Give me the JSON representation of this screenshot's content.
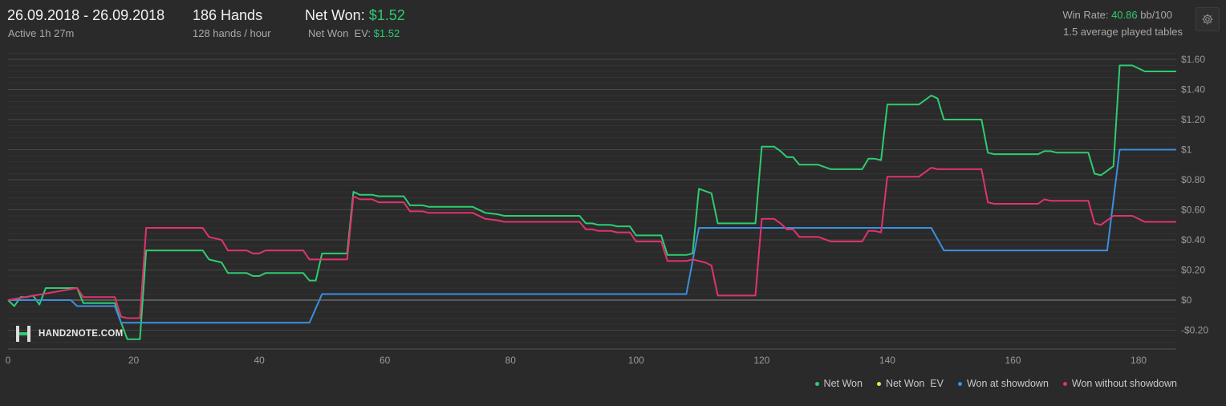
{
  "header": {
    "date_range": "26.09.2018 - 26.09.2018",
    "active": "Active 1h 27m",
    "hands": "186 Hands",
    "hands_per_hour": "128 hands / hour",
    "net_won_label": "Net Won: ",
    "net_won_value": "$1.52",
    "net_won_ev_label": "Net Won  EV: ",
    "net_won_ev_value": "$1.52",
    "win_rate_label": "Win Rate: ",
    "win_rate_value": "40.86",
    "win_rate_unit": " bb/100",
    "tables": "1.5 average played tables"
  },
  "logo": {
    "text": "HAND2NOTE.COM"
  },
  "colors": {
    "net_won": "#2ecc71",
    "net_won_ev": "#e8e84a",
    "showdown": "#3b8fe0",
    "non_showdown": "#e0336e",
    "background": "#2a2a2a",
    "grid": "#3c3c3c",
    "zero_line": "#8a8a8a"
  },
  "icons": {
    "settings": "gear-icon"
  },
  "chart_data": {
    "type": "line",
    "xlim": [
      0,
      186
    ],
    "ylim": [
      -0.3,
      1.65
    ],
    "x_ticks": [
      0,
      20,
      40,
      60,
      80,
      100,
      120,
      140,
      160,
      180
    ],
    "x_tick_labels": [
      "0",
      "20",
      "40",
      "60",
      "80",
      "100",
      "120",
      "140",
      "160",
      "180"
    ],
    "y_ticks": [
      -0.2,
      0,
      0.2,
      0.4,
      0.6,
      0.8,
      1,
      1.2,
      1.4,
      1.6
    ],
    "y_tick_labels": [
      "-$0.20",
      "$0",
      "$0.20",
      "$0.40",
      "$0.60",
      "$0.80",
      "$1",
      "$1.20",
      "$1.40",
      "$1.60"
    ],
    "grid": true,
    "legend_position": "bottom-right",
    "series": [
      {
        "name": "Net Won",
        "color": "#2ecc71",
        "points": [
          [
            0,
            0
          ],
          [
            1,
            -0.04
          ],
          [
            2,
            0.02
          ],
          [
            3,
            0.02
          ],
          [
            4,
            0.03
          ],
          [
            5,
            -0.03
          ],
          [
            6,
            0.08
          ],
          [
            11,
            0.08
          ],
          [
            12,
            -0.02
          ],
          [
            17,
            -0.02
          ],
          [
            18,
            -0.15
          ],
          [
            19,
            -0.26
          ],
          [
            21,
            -0.26
          ],
          [
            22,
            0.33
          ],
          [
            31,
            0.33
          ],
          [
            32,
            0.27
          ],
          [
            34,
            0.25
          ],
          [
            35,
            0.18
          ],
          [
            38,
            0.18
          ],
          [
            39,
            0.16
          ],
          [
            40,
            0.16
          ],
          [
            41,
            0.18
          ],
          [
            47,
            0.18
          ],
          [
            48,
            0.13
          ],
          [
            49,
            0.13
          ],
          [
            50,
            0.31
          ],
          [
            54,
            0.31
          ],
          [
            55,
            0.72
          ],
          [
            56,
            0.7
          ],
          [
            58,
            0.7
          ],
          [
            59,
            0.69
          ],
          [
            63,
            0.69
          ],
          [
            64,
            0.63
          ],
          [
            66,
            0.63
          ],
          [
            67,
            0.62
          ],
          [
            74,
            0.62
          ],
          [
            76,
            0.58
          ],
          [
            78,
            0.57
          ],
          [
            79,
            0.56
          ],
          [
            91,
            0.56
          ],
          [
            92,
            0.51
          ],
          [
            93,
            0.51
          ],
          [
            94,
            0.5
          ],
          [
            96,
            0.5
          ],
          [
            97,
            0.49
          ],
          [
            99,
            0.49
          ],
          [
            100,
            0.43
          ],
          [
            104,
            0.43
          ],
          [
            105,
            0.3
          ],
          [
            108,
            0.3
          ],
          [
            109,
            0.31
          ],
          [
            110,
            0.74
          ],
          [
            112,
            0.71
          ],
          [
            113,
            0.51
          ],
          [
            119,
            0.51
          ],
          [
            120,
            1.02
          ],
          [
            122,
            1.02
          ],
          [
            123,
            0.99
          ],
          [
            124,
            0.95
          ],
          [
            125,
            0.95
          ],
          [
            126,
            0.9
          ],
          [
            129,
            0.9
          ],
          [
            131,
            0.87
          ],
          [
            136,
            0.87
          ],
          [
            137,
            0.94
          ],
          [
            138,
            0.94
          ],
          [
            139,
            0.93
          ],
          [
            140,
            1.3
          ],
          [
            145,
            1.3
          ],
          [
            147,
            1.36
          ],
          [
            148,
            1.34
          ],
          [
            149,
            1.2
          ],
          [
            155,
            1.2
          ],
          [
            156,
            0.98
          ],
          [
            157,
            0.97
          ],
          [
            164,
            0.97
          ],
          [
            165,
            0.99
          ],
          [
            166,
            0.99
          ],
          [
            167,
            0.98
          ],
          [
            172,
            0.98
          ],
          [
            173,
            0.84
          ],
          [
            174,
            0.83
          ],
          [
            175,
            0.86
          ],
          [
            176,
            0.89
          ],
          [
            177,
            1.56
          ],
          [
            179,
            1.56
          ],
          [
            181,
            1.52
          ],
          [
            186,
            1.52
          ]
        ]
      },
      {
        "name": "Net Won  EV",
        "color": "#e8e84a",
        "points": []
      },
      {
        "name": "Won at showdown",
        "color": "#3b8fe0",
        "points": [
          [
            0,
            0
          ],
          [
            10,
            0
          ],
          [
            11,
            -0.04
          ],
          [
            17,
            -0.04
          ],
          [
            18,
            -0.15
          ],
          [
            48,
            -0.15
          ],
          [
            50,
            0.04
          ],
          [
            108,
            0.04
          ],
          [
            110,
            0.48
          ],
          [
            147,
            0.48
          ],
          [
            149,
            0.33
          ],
          [
            175,
            0.33
          ],
          [
            177,
            1.0
          ],
          [
            186,
            1.0
          ]
        ]
      },
      {
        "name": "Won without showdown",
        "color": "#e0336e",
        "points": [
          [
            0,
            0
          ],
          [
            11,
            0.08
          ],
          [
            12,
            0.02
          ],
          [
            17,
            0.02
          ],
          [
            18,
            -0.11
          ],
          [
            19,
            -0.12
          ],
          [
            21,
            -0.12
          ],
          [
            22,
            0.48
          ],
          [
            31,
            0.48
          ],
          [
            32,
            0.42
          ],
          [
            34,
            0.4
          ],
          [
            35,
            0.33
          ],
          [
            38,
            0.33
          ],
          [
            39,
            0.31
          ],
          [
            40,
            0.31
          ],
          [
            41,
            0.33
          ],
          [
            47,
            0.33
          ],
          [
            48,
            0.27
          ],
          [
            49,
            0.27
          ],
          [
            50,
            0.27
          ],
          [
            54,
            0.27
          ],
          [
            55,
            0.69
          ],
          [
            56,
            0.67
          ],
          [
            58,
            0.67
          ],
          [
            59,
            0.65
          ],
          [
            63,
            0.65
          ],
          [
            64,
            0.59
          ],
          [
            66,
            0.59
          ],
          [
            67,
            0.58
          ],
          [
            74,
            0.58
          ],
          [
            76,
            0.54
          ],
          [
            78,
            0.53
          ],
          [
            79,
            0.52
          ],
          [
            91,
            0.52
          ],
          [
            92,
            0.47
          ],
          [
            93,
            0.47
          ],
          [
            94,
            0.46
          ],
          [
            96,
            0.46
          ],
          [
            97,
            0.45
          ],
          [
            99,
            0.45
          ],
          [
            100,
            0.39
          ],
          [
            104,
            0.39
          ],
          [
            105,
            0.26
          ],
          [
            108,
            0.26
          ],
          [
            109,
            0.27
          ],
          [
            111,
            0.25
          ],
          [
            112,
            0.23
          ],
          [
            113,
            0.03
          ],
          [
            119,
            0.03
          ],
          [
            120,
            0.54
          ],
          [
            122,
            0.54
          ],
          [
            123,
            0.51
          ],
          [
            124,
            0.47
          ],
          [
            125,
            0.47
          ],
          [
            126,
            0.42
          ],
          [
            129,
            0.42
          ],
          [
            131,
            0.39
          ],
          [
            136,
            0.39
          ],
          [
            137,
            0.46
          ],
          [
            138,
            0.46
          ],
          [
            139,
            0.45
          ],
          [
            140,
            0.82
          ],
          [
            145,
            0.82
          ],
          [
            147,
            0.88
          ],
          [
            148,
            0.87
          ],
          [
            155,
            0.87
          ],
          [
            156,
            0.65
          ],
          [
            157,
            0.64
          ],
          [
            164,
            0.64
          ],
          [
            165,
            0.67
          ],
          [
            166,
            0.66
          ],
          [
            172,
            0.66
          ],
          [
            173,
            0.51
          ],
          [
            174,
            0.5
          ],
          [
            175,
            0.53
          ],
          [
            176,
            0.56
          ],
          [
            178,
            0.56
          ],
          [
            179,
            0.56
          ],
          [
            181,
            0.52
          ],
          [
            186,
            0.52
          ]
        ]
      }
    ]
  }
}
